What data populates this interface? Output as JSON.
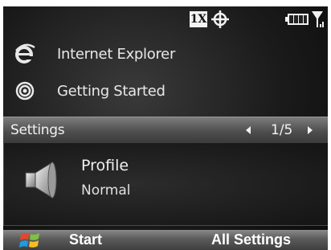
{
  "status_bar": {
    "network_badge": "1X",
    "icons": [
      "gps-icon",
      "battery-icon",
      "signal-icon"
    ]
  },
  "items": [
    {
      "label": "Internet Explorer",
      "icon": "internet-explorer-icon"
    },
    {
      "label": "Getting Started",
      "icon": "getting-started-icon"
    }
  ],
  "settings": {
    "title": "Settings",
    "page_indicator": "1/5",
    "profile_label": "Profile",
    "profile_value": "Normal",
    "icon": "speaker-icon"
  },
  "soft_keys": {
    "left": "Start",
    "right": "All Settings",
    "icon": "windows-start-icon"
  },
  "colors": {
    "background": "#1a1a1a",
    "text": "#e8e8e8",
    "ie_blue": "#2f8fe0",
    "battery_green": "#7fd14a"
  }
}
